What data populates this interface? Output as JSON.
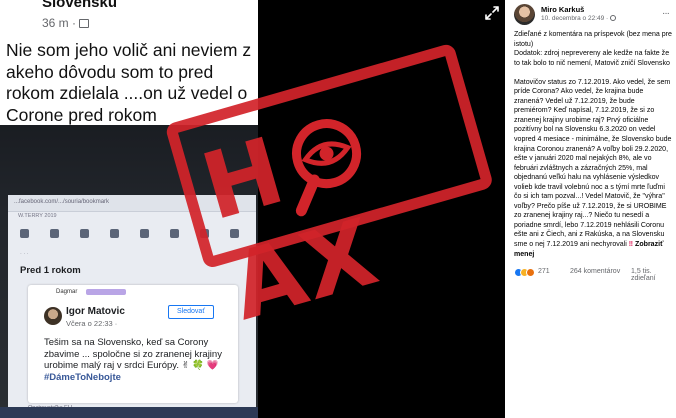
{
  "photo": {
    "phone": {
      "name": "Slovensku",
      "time": "36 m ·",
      "text": "Nie som jeho volič ani neviem z akeho dôvodu som to pred rokom zdielala ....on už vedel o Corone pred rokom"
    },
    "laptop": {
      "url": "...facebook.com/.../souria/bookmark",
      "meta": "W.TERRY 2019",
      "subheading": "Pred 1 rokom",
      "user": "Dagmar",
      "card": {
        "name": "Igor Matovic",
        "date": "Včera o 22:33 · ",
        "follow": "Sledovať",
        "text": "Tešim sa na Slovensko, keď sa Corony zbavime ... spoločne si zo zranenej krajiny urobime malý raj v srdci Európy. ✌ 🍀 💗",
        "hashtag": "#DámeToNebojte"
      },
      "footer": "Opatrovateľka ELI"
    },
    "stamp_text": "HOAX"
  },
  "post": {
    "author": "Miro Karkuš",
    "date": "10. decembra o 22:49 · ",
    "more_label": "···",
    "body": "Zdieľané z komentára na príspevok (bez mena pre istotu)\nDodatok: zdroj neprevereny ale kedže na fakte že to tak bolo to nič nemení, Matovič zničí Slovensko\n\nMatovičov status zo 7.12.2019. Ako vedel, že sem príde Corona? Ako vedel, že krajina bude zranená? Vedel už 7.12.2019, že bude premiérom? Keď napísal, 7.12.2019, že si zo zranenej krajiny urobime raj? Prvý oficiálne pozitívny bol na Slovensku 6.3.2020 on vedel vopred 4 mesiace - minimálne, že Slovensko bude krajina Coronou zranená? A voľby boli 29.2.2020, ešte v januári 2020 mal nejakých 8%, ale vo februári zvláštnych a zázračných 25%, mal objednanú veľkú halu na vyhlásenie výsledkov volieb kde travil volebnú noc a s týmí mrte ľuďmi čo si ich tam pozval...! Vedel Matovič, že \"výhra\" voľby? Prečo píše už 7.12.2019, že si UROBIME zo zranenej krajiny raj...? Niečo tu nesedí a poriadne smrdí, lebo 7.12.2019 nehlásili Coronu ešte ani z Čiech, ani z Rakúska, a na Slovensku sme o nej 7.12.2019 ani nechyrovali",
    "warning_marks": "‼",
    "see_more": "Zobraziť menej",
    "reactions_count": "271",
    "comments_count": "264 komentárov",
    "shares_count": "1,5 tis. zdieľaní"
  },
  "colors": {
    "stamp": "#d2242a",
    "like": "#1877f2",
    "wow": "#f7b125",
    "angry": "#e9710f"
  },
  "icons": [
    "expand-icon",
    "globe-icon",
    "more-icon",
    "like-reaction-icon",
    "wow-reaction-icon",
    "angry-reaction-icon",
    "magnifier-eye-icon"
  ]
}
